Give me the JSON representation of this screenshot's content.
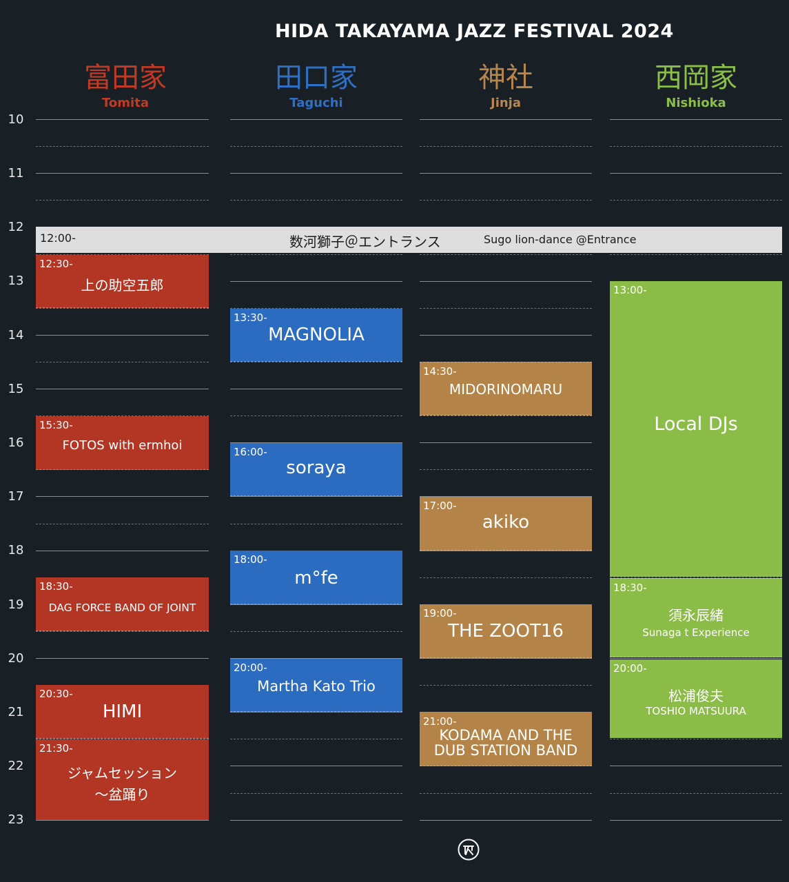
{
  "title": "HIDA TAKAYAMA JAZZ FESTIVAL 2024",
  "venues": [
    {
      "jp": "富田家",
      "en": "Tomita",
      "color": "#c23a24"
    },
    {
      "jp": "田口家",
      "en": "Taguchi",
      "color": "#2f6fc4"
    },
    {
      "jp": "神社",
      "en": "Jinja",
      "color": "#b8864a"
    },
    {
      "jp": "西岡家",
      "en": "Nishioka",
      "color": "#8cbf47"
    }
  ],
  "hours": [
    "10",
    "11",
    "12",
    "13",
    "14",
    "15",
    "16",
    "17",
    "18",
    "19",
    "20",
    "21",
    "22",
    "23"
  ],
  "banner": {
    "time": "12:00-",
    "jp": "数河獅子＠エントランス",
    "en": "Sugo lion-dance @Entrance"
  },
  "tomita": [
    {
      "time": "12:30-",
      "act": "上の助空五郎"
    },
    {
      "time": "15:30-",
      "act": "FOTOS with ermhoi"
    },
    {
      "time": "18:30-",
      "act": "DAG FORCE BAND OF JOINT"
    },
    {
      "time": "20:30-",
      "act": "HIMI"
    },
    {
      "time": "21:30-",
      "act": "ジャムセッション\n〜盆踊り"
    }
  ],
  "taguchi": [
    {
      "time": "13:30-",
      "act": "MAGNOLIA"
    },
    {
      "time": "16:00-",
      "act": "soraya"
    },
    {
      "time": "18:00-",
      "act": "m°fe"
    },
    {
      "time": "20:00-",
      "act": "Martha Kato Trio"
    }
  ],
  "jinja": [
    {
      "time": "14:30-",
      "act": "MIDORINOMARU"
    },
    {
      "time": "17:00-",
      "act": "akiko"
    },
    {
      "time": "19:00-",
      "act": "THE ZOOT16"
    },
    {
      "time": "21:00-",
      "act": "KODAMA AND THE\nDUB STATION BAND"
    }
  ],
  "nishioka": [
    {
      "time": "13:00-",
      "act": "Local DJs"
    },
    {
      "time": "18:30-",
      "act": "須永辰緒",
      "sub": "Sunaga t Experience"
    },
    {
      "time": "20:00-",
      "act": "松浦俊夫",
      "sub": "TOSHIO MATSUURA"
    }
  ]
}
